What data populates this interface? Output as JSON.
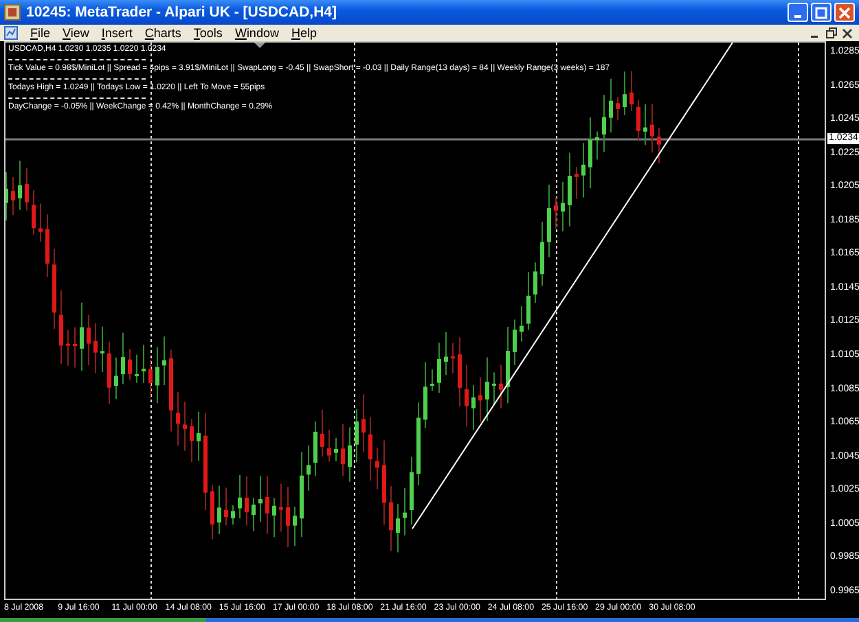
{
  "window": {
    "title": "10245: MetaTrader - Alpari UK - [USDCAD,H4]"
  },
  "menu": [
    "File",
    "View",
    "Insert",
    "Charts",
    "Tools",
    "Window",
    "Help"
  ],
  "chart": {
    "info_lines": [
      "USDCAD,H4  1.0230 1.0235 1.0220 1.0234",
      "Tick Value = 0.98$/MiniLot || Spread = 4pips = 3.91$/MiniLot || SwapLong = -0.45 || SwapShort = -0.03 || Daily Range(13 days) = 84 || Weekly Range(3 weeks) = 187",
      "Todays High = 1.0249 || Todays Low = 1.0220 || Left To Move = 55pips",
      "DayChange = -0.05% || WeekChange = 0.42% || MonthChange = 0.29%"
    ],
    "current_price": "1.0234",
    "price_axis": [
      "1.0285",
      "1.0265",
      "1.0245",
      "1.0225",
      "1.0205",
      "1.0185",
      "1.0165",
      "1.0145",
      "1.0125",
      "1.0105",
      "1.0085",
      "1.0065",
      "1.0045",
      "1.0025",
      "1.0005",
      "0.9985",
      "0.9965"
    ],
    "time_axis": [
      "8 Jul 2008",
      "9 Jul 16:00",
      "11 Jul 00:00",
      "14 Jul 08:00",
      "15 Jul 16:00",
      "17 Jul 00:00",
      "18 Jul 08:00",
      "21 Jul 16:00",
      "23 Jul 00:00",
      "24 Jul 08:00",
      "25 Jul 16:00",
      "29 Jul 00:00",
      "30 Jul 08:00"
    ]
  }
}
